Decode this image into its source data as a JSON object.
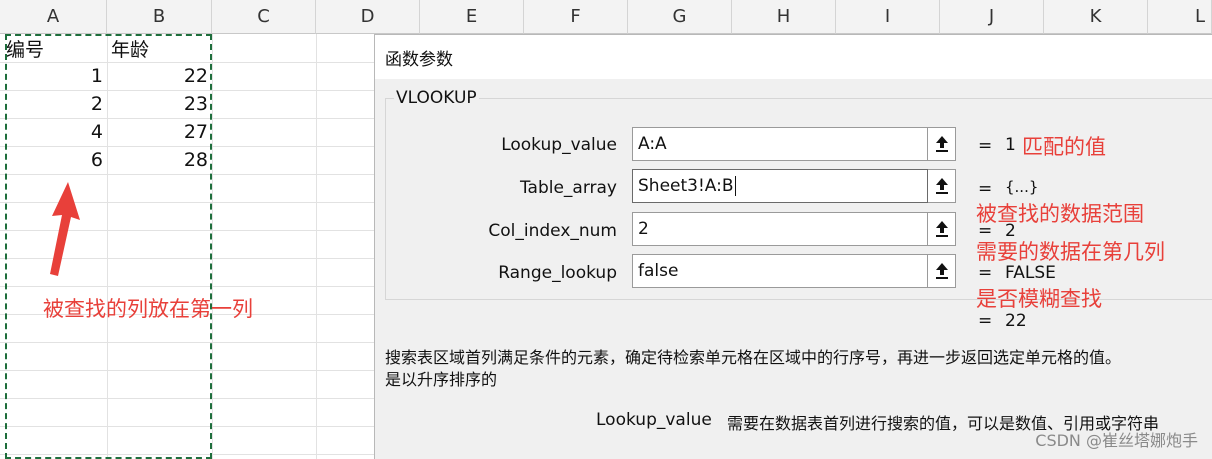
{
  "spreadsheet": {
    "column_headers": [
      "A",
      "B",
      "C",
      "D",
      "E",
      "F",
      "G",
      "H",
      "I",
      "J",
      "K",
      "L"
    ],
    "rows": [
      {
        "a": "编号",
        "b": "年龄"
      },
      {
        "a": "1",
        "b": "22"
      },
      {
        "a": "2",
        "b": "23"
      },
      {
        "a": "4",
        "b": "27"
      },
      {
        "a": "6",
        "b": "28"
      }
    ]
  },
  "annotations": {
    "left_note": "被查找的列放在第一列",
    "lookup_value_note": "匹配的值",
    "table_array_note": "被查找的数据范围",
    "col_index_note": "需要的数据在第几列",
    "range_lookup_note": "是否模糊查找"
  },
  "dialog": {
    "title": "函数参数",
    "function_name": "VLOOKUP",
    "args": [
      {
        "label": "Lookup_value",
        "value": "A:A",
        "equals": "=",
        "result": "1"
      },
      {
        "label": "Table_array",
        "value": "Sheet3!A:B",
        "equals": "=",
        "result": "{...}"
      },
      {
        "label": "Col_index_num",
        "value": "2",
        "equals": "=",
        "result": "2"
      },
      {
        "label": "Range_lookup",
        "value": "false",
        "equals": "=",
        "result": "FALSE"
      }
    ],
    "formula_result_equals": "=",
    "formula_result": "22",
    "description_line1": "搜索表区域首列满足条件的元素，确定待检索单元格在区域中的行序号，再进一步返回选定单元格的值。",
    "description_line2": "是以升序排序的",
    "arg_help_name": "Lookup_value",
    "arg_help_text": "需要在数据表首列进行搜索的值，可以是数值、引用或字符串"
  },
  "watermark": "CSDN @崔丝塔娜炮手",
  "colors": {
    "annotation": "#e8403a",
    "copy_marquee": "#1e6e3c",
    "dialog_bg": "#f0f0f0"
  },
  "icons": {
    "collapse_button": "collapse-dialog-arrow-icon",
    "annotation_arrow": "up-arrow-icon"
  }
}
